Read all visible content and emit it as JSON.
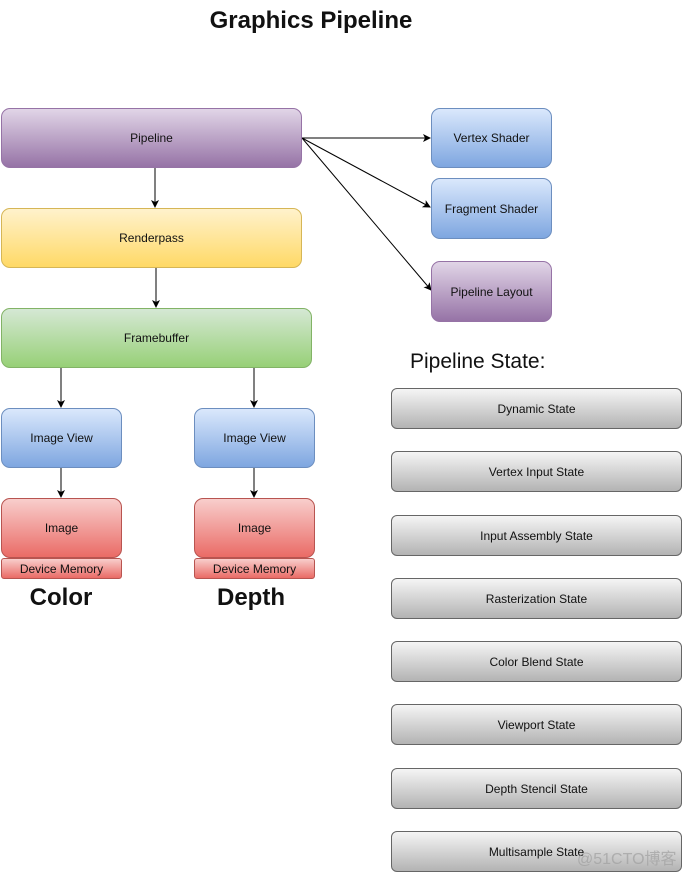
{
  "title": "Graphics Pipeline",
  "nodes": {
    "pipeline": "Pipeline",
    "renderpass": "Renderpass",
    "framebuffer": "Framebuffer",
    "vertex_shader": "Vertex Shader",
    "fragment_shader": "Fragment Shader",
    "pipeline_layout": "Pipeline Layout",
    "color_image_view": "Image View",
    "depth_image_view": "Image View",
    "color_image": "Image",
    "depth_image": "Image",
    "color_device_memory": "Device Memory",
    "depth_device_memory": "Device Memory"
  },
  "labels": {
    "color": "Color",
    "depth": "Depth"
  },
  "pipeline_state": {
    "heading": "Pipeline State:",
    "items": [
      "Dynamic State",
      "Vertex Input State",
      "Input Assembly State",
      "Rasterization State",
      "Color Blend State",
      "Viewport State",
      "Depth Stencil State",
      "Multisample State"
    ]
  },
  "colors": {
    "purple": "#9673a6",
    "yellow": "#d6b656",
    "green": "#82b366",
    "blue": "#6c8ebf",
    "red": "#b85450",
    "grey": "#666666"
  },
  "watermark": "@51CTO博客"
}
